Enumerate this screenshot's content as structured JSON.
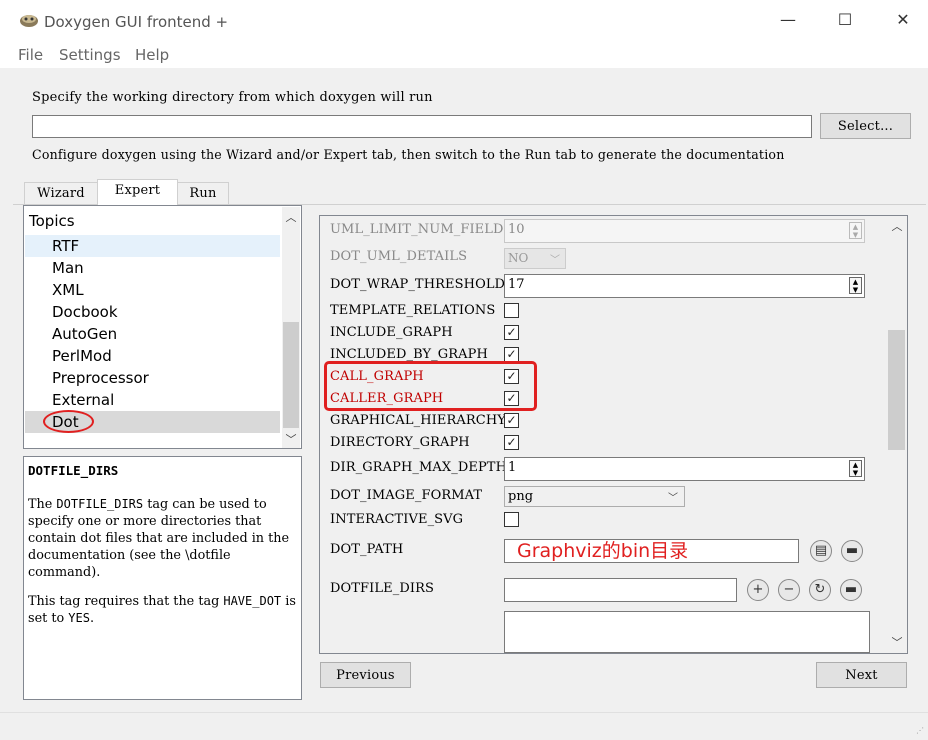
{
  "window": {
    "title": "Doxygen GUI frontend +",
    "minimize": "—",
    "maximize": "☐",
    "close": "✕"
  },
  "menu": {
    "file": "File",
    "settings": "Settings",
    "help": "Help"
  },
  "workdir": {
    "label": "Specify the working directory from which doxygen will run",
    "value": "",
    "select_label": "Select...",
    "hint": "Configure doxygen using the Wizard and/or Expert tab, then switch to the Run tab to generate the documentation"
  },
  "tabs": [
    {
      "label": "Wizard"
    },
    {
      "label": "Expert"
    },
    {
      "label": "Run"
    }
  ],
  "topics": {
    "header": "Topics",
    "items": [
      {
        "label": "RTF"
      },
      {
        "label": "Man"
      },
      {
        "label": "XML"
      },
      {
        "label": "Docbook"
      },
      {
        "label": "AutoGen"
      },
      {
        "label": "PerlMod"
      },
      {
        "label": "Preprocessor"
      },
      {
        "label": "External"
      },
      {
        "label": "Dot"
      }
    ],
    "selected": "Dot"
  },
  "description": {
    "title": "DOTFILE_DIRS",
    "para1_pre": "The ",
    "para1_code": "DOTFILE_DIRS",
    "para1_post": " tag can be used to specify one or more directories that contain dot files that are included in the documentation (see the \\dotfile command).",
    "para2_pre": "This tag requires that the tag ",
    "para2_code1": "HAVE_DOT",
    "para2_mid": " is set to ",
    "para2_code2": "YES",
    "para2_end": "."
  },
  "settings": {
    "uml_limit_num_fields": {
      "label": "UML_LIMIT_NUM_FIELDS",
      "value": "10"
    },
    "dot_uml_details": {
      "label": "DOT_UML_DETAILS",
      "value": "NO"
    },
    "dot_wrap_threshold": {
      "label": "DOT_WRAP_THRESHOLD",
      "value": "17"
    },
    "template_relations": {
      "label": "TEMPLATE_RELATIONS",
      "checked": false
    },
    "include_graph": {
      "label": "INCLUDE_GRAPH",
      "checked": true
    },
    "included_by_graph": {
      "label": "INCLUDED_BY_GRAPH",
      "checked": true
    },
    "call_graph": {
      "label": "CALL_GRAPH",
      "checked": true
    },
    "caller_graph": {
      "label": "CALLER_GRAPH",
      "checked": true
    },
    "graphical_hierarchy": {
      "label": "GRAPHICAL_HIERARCHY",
      "checked": true
    },
    "directory_graph": {
      "label": "DIRECTORY_GRAPH",
      "checked": true
    },
    "dir_graph_max_depth": {
      "label": "DIR_GRAPH_MAX_DEPTH",
      "value": "1"
    },
    "dot_image_format": {
      "label": "DOT_IMAGE_FORMAT",
      "value": "png"
    },
    "interactive_svg": {
      "label": "INTERACTIVE_SVG",
      "checked": false
    },
    "dot_path": {
      "label": "DOT_PATH",
      "value": "Graphviz的bin目录"
    },
    "dotfile_dirs": {
      "label": "DOTFILE_DIRS",
      "value": ""
    }
  },
  "nav": {
    "previous": "Previous",
    "next": "Next"
  },
  "check_glyph": "✓",
  "colors": {
    "annotation_red": "#e02020",
    "highlight_label": "#c00000"
  }
}
